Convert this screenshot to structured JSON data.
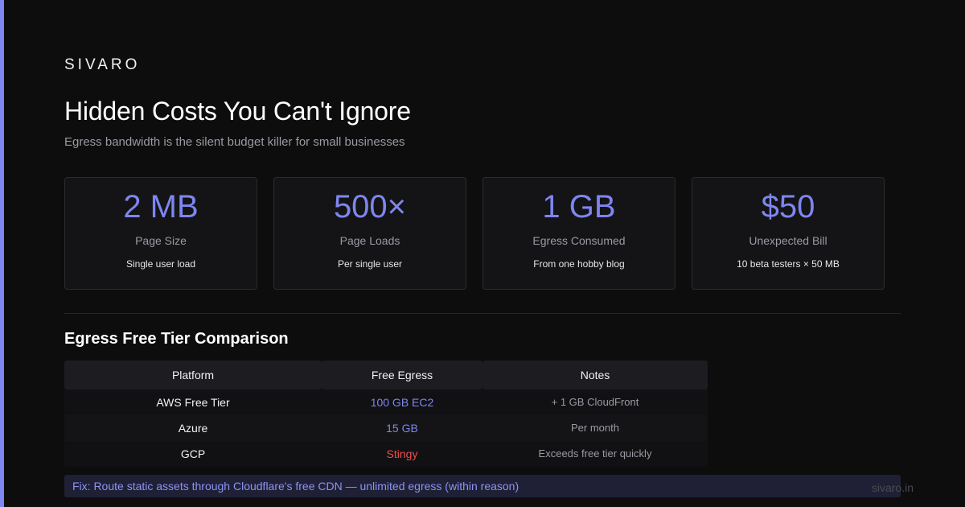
{
  "brand": "SIVARO",
  "title": "Hidden Costs You Can't Ignore",
  "subtitle": "Egress bandwidth is the silent budget killer for small businesses",
  "stats": [
    {
      "value": "2 MB",
      "label": "Page Size",
      "note": "Single user load"
    },
    {
      "value": "500×",
      "label": "Page Loads",
      "note": "Per single user"
    },
    {
      "value": "1 GB",
      "label": "Egress Consumed",
      "note": "From one hobby blog"
    },
    {
      "value": "$50",
      "label": "Unexpected Bill",
      "note": "10 beta testers × 50 MB"
    }
  ],
  "comparison": {
    "title": "Egress Free Tier Comparison",
    "headers": [
      "Platform",
      "Free Egress",
      "Notes"
    ],
    "rows": [
      {
        "platform": "AWS Free Tier",
        "egress": "100 GB EC2",
        "notes": "+ 1 GB CloudFront"
      },
      {
        "platform": "Azure",
        "egress": "15 GB",
        "notes": "Per month"
      },
      {
        "platform": "GCP",
        "egress": "Stingy",
        "notes": "Exceeds free tier quickly"
      }
    ]
  },
  "fix": "Fix: Route static assets through Cloudflare's free CDN — unlimited egress (within reason)",
  "footer_url": "sivaro.in",
  "colors": {
    "accent": "#7e86ef",
    "warning": "#ef4e4e",
    "background": "#0d0d0e"
  }
}
